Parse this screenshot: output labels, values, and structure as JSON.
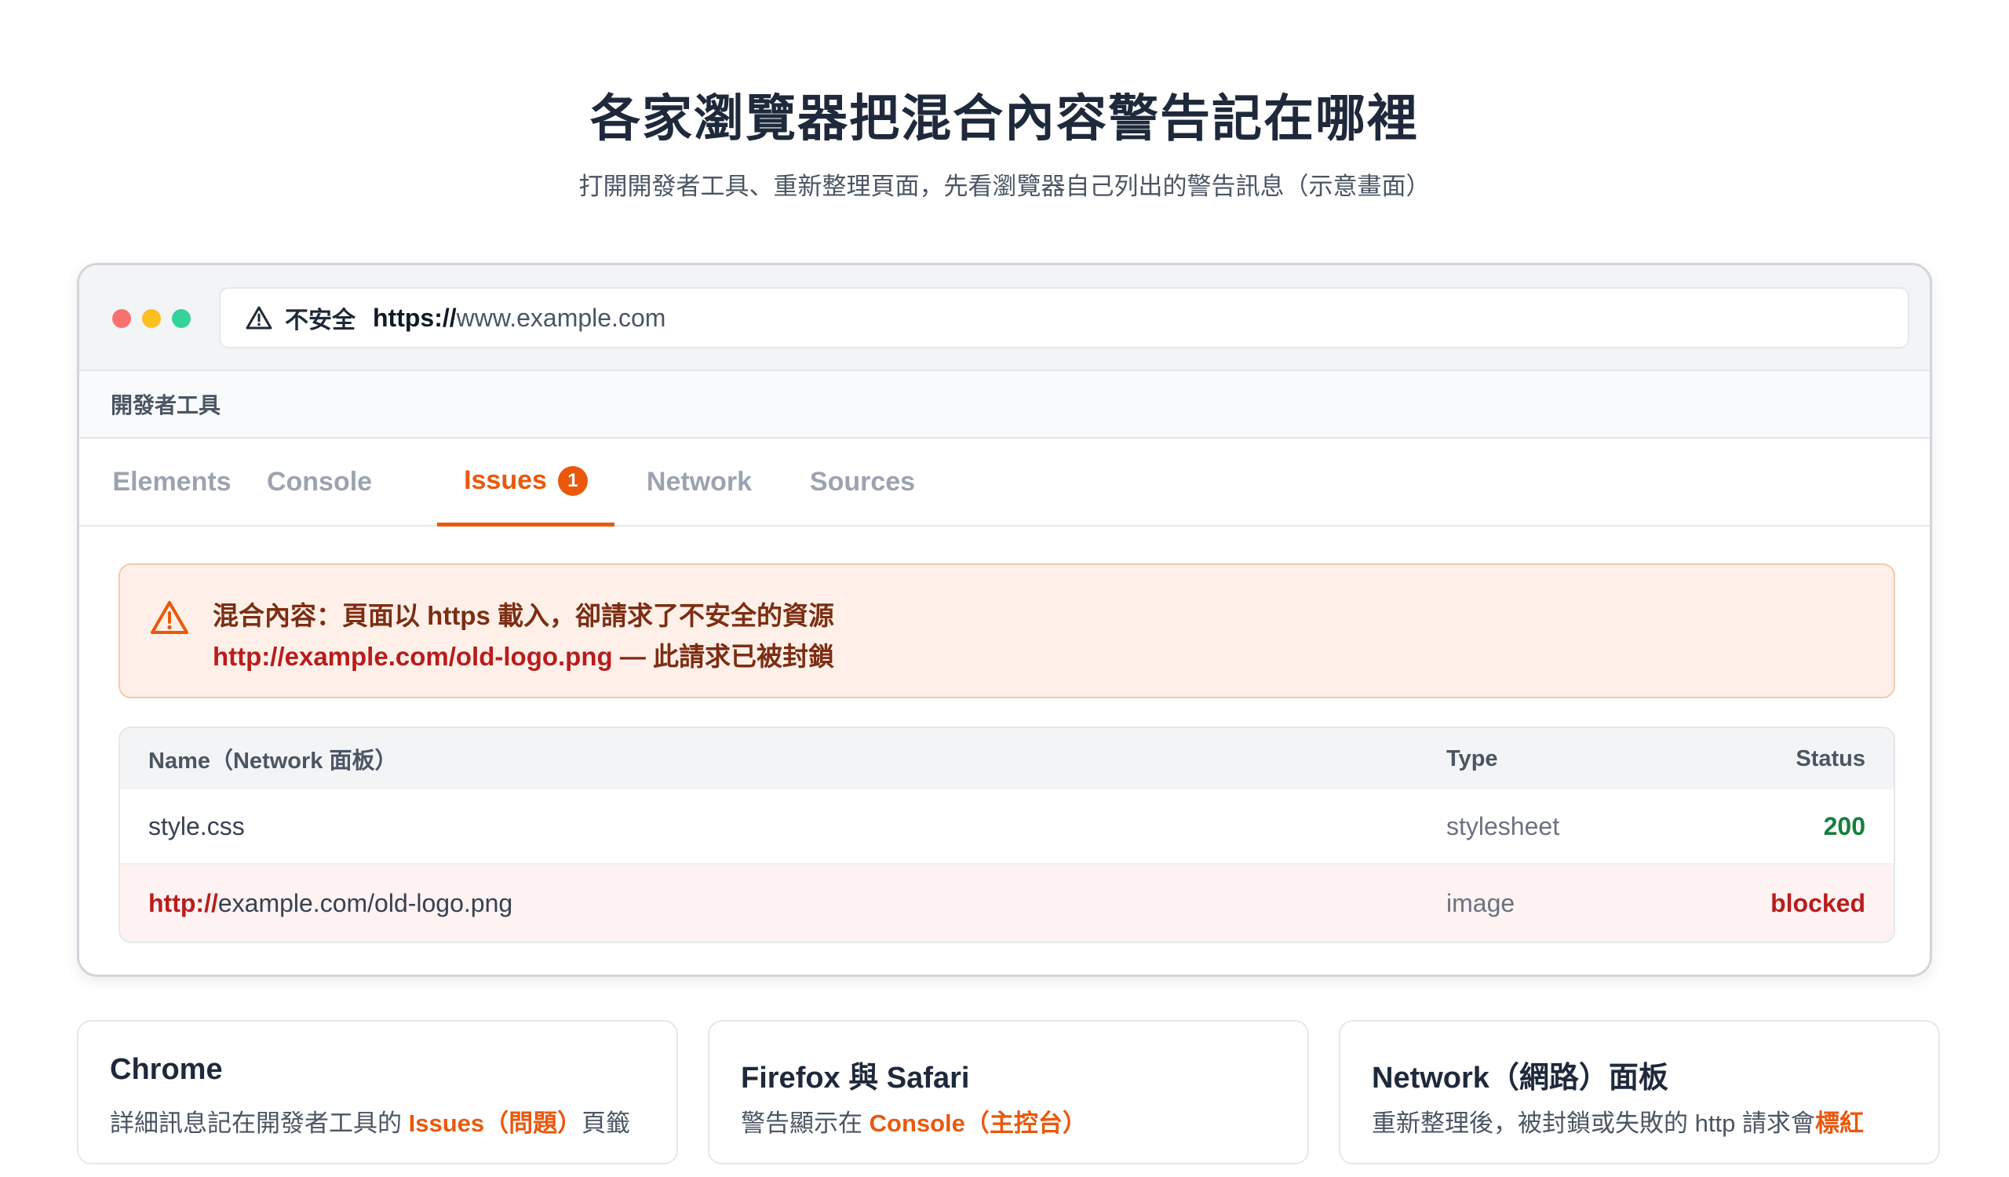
{
  "header": {
    "title": "各家瀏覽器把混合內容警告記在哪裡",
    "subtitle": "打開開發者工具、重新整理頁面，先看瀏覽器自己列出的警告訊息（示意畫面）"
  },
  "browser": {
    "address_bar": {
      "security_label": "不安全",
      "scheme": "https://",
      "host": "www.example.com"
    },
    "devtools_label": "開發者工具",
    "tabs": [
      {
        "label": "Elements"
      },
      {
        "label": "Console"
      },
      {
        "label": "Issues",
        "badge": "1",
        "active": true
      },
      {
        "label": "Network"
      },
      {
        "label": "Sources"
      }
    ],
    "alert": {
      "line1": "混合內容：頁面以 https 載入，卻請求了不安全的資源",
      "url": "http://example.com/old-logo.png",
      "line2_suffix": " — 此請求已被封鎖"
    },
    "network_table": {
      "headers": {
        "name": "Name（Network 面板）",
        "type": "Type",
        "status": "Status"
      },
      "rows": [
        {
          "name": "style.css",
          "type": "stylesheet",
          "status": "200"
        },
        {
          "name_scheme": "http://",
          "name_host": "example.com/old-logo.png",
          "type": "image",
          "status": "blocked"
        }
      ]
    }
  },
  "cards": [
    {
      "title": "Chrome",
      "text_prefix": "詳細訊息記在開發者工具的 ",
      "highlight": "Issues（問題）",
      "text_suffix": "頁籤"
    },
    {
      "title": "Firefox 與 Safari",
      "text_prefix": "警告顯示在 ",
      "highlight": "Console（主控台）",
      "text_suffix": ""
    },
    {
      "title": "Network（網路）面板",
      "text_prefix": "重新整理後，被封鎖或失敗的 http 請求會",
      "highlight": "標紅",
      "text_suffix": ""
    }
  ],
  "colors": {
    "accent": "#ea580c",
    "danger": "#b91c1c",
    "success": "#15803d"
  },
  "icons": {
    "address_warning": "warning-triangle-icon",
    "alert_warning": "warning-triangle-icon"
  }
}
